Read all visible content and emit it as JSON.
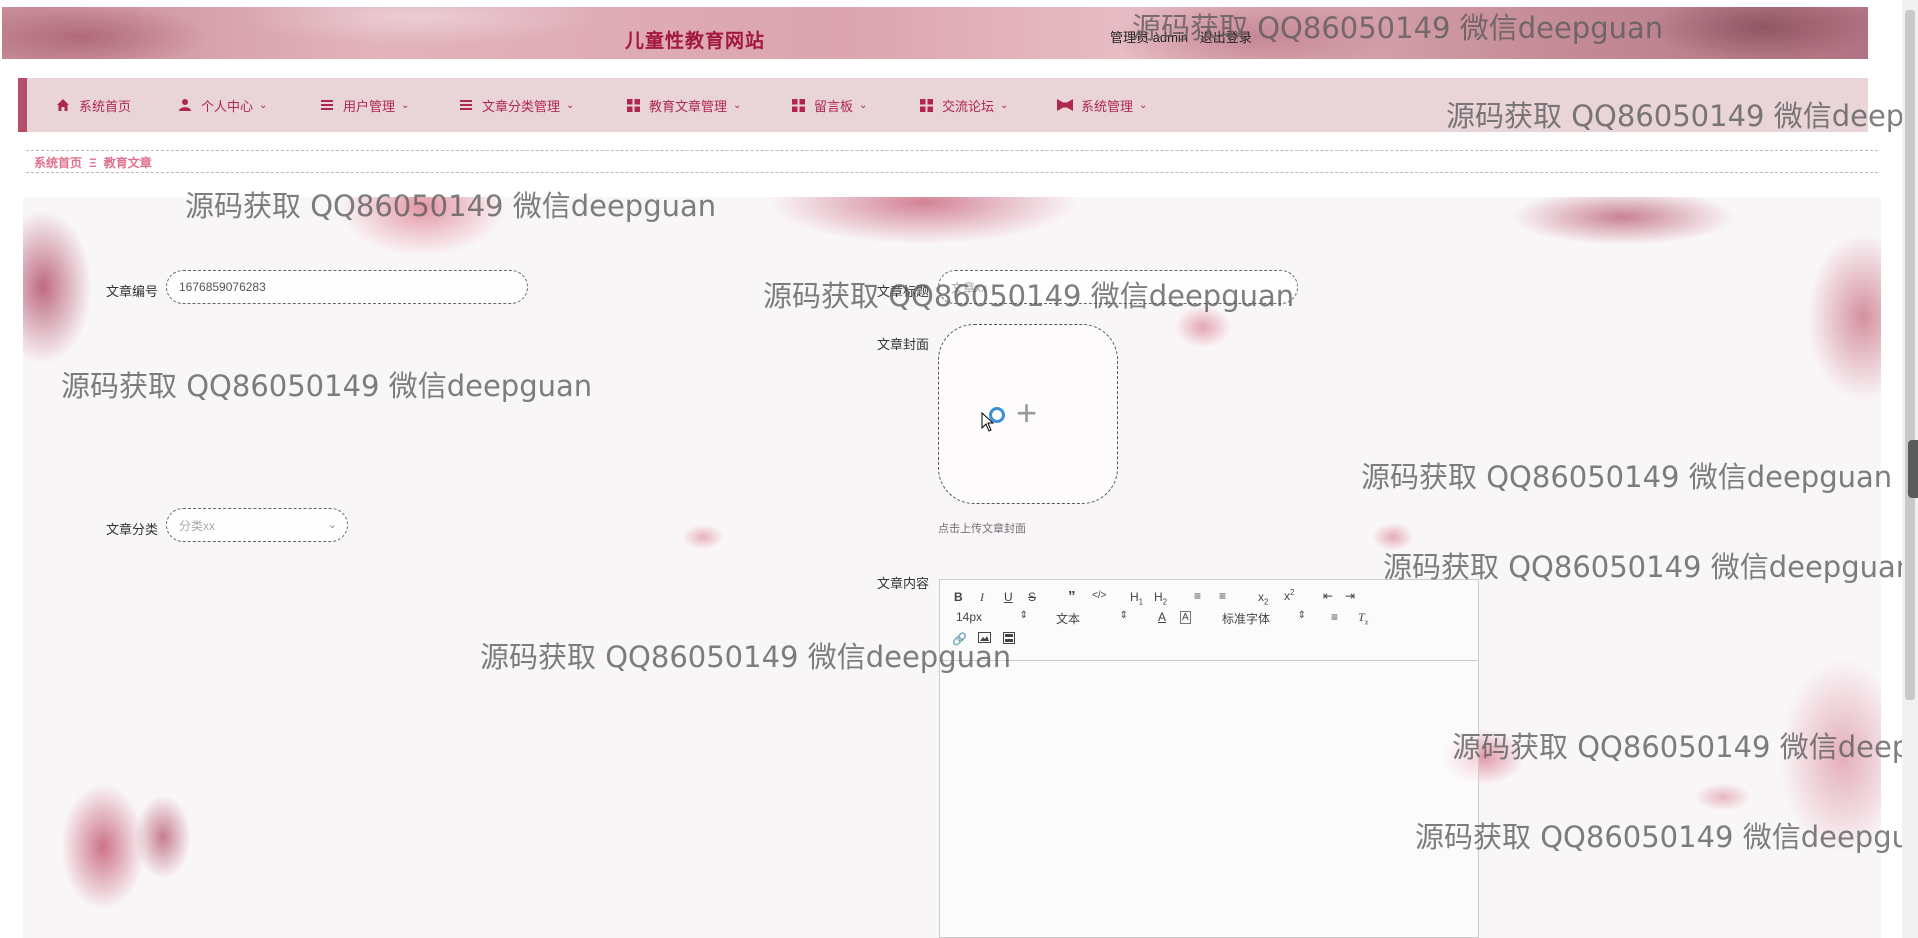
{
  "header": {
    "site_title": "儿童性教育网站",
    "user_role": "管理员",
    "username": "admin",
    "logout": "退出登录"
  },
  "nav": {
    "items": [
      {
        "label": "系统首页",
        "icon": "home-icon",
        "dropdown": false
      },
      {
        "label": "个人中心",
        "icon": "user-icon",
        "dropdown": true
      },
      {
        "label": "用户管理",
        "icon": "list-icon",
        "dropdown": true
      },
      {
        "label": "文章分类管理",
        "icon": "list-icon",
        "dropdown": true
      },
      {
        "label": "教育文章管理",
        "icon": "grid-icon",
        "dropdown": true
      },
      {
        "label": "留言板",
        "icon": "grid-icon",
        "dropdown": true
      },
      {
        "label": "交流论坛",
        "icon": "grid-icon",
        "dropdown": true
      },
      {
        "label": "系统管理",
        "icon": "bowtie-icon",
        "dropdown": true
      }
    ]
  },
  "breadcrumb": {
    "home": "系统首页",
    "separator": "Ξ",
    "current": "教育文章"
  },
  "form": {
    "article_no_label": "文章编号",
    "article_no_value": "1676859076283",
    "title_label": "文章标题",
    "title_placeholder": "文章xx",
    "cover_label": "文章封面",
    "cover_tip": "点击上传文章封面",
    "category_label": "文章分类",
    "category_placeholder": "分类xx",
    "content_label": "文章内容"
  },
  "editor": {
    "font_size": "14px",
    "block_format": "文本",
    "font_family": "标准字体"
  },
  "watermark": "源码获取 QQ86050149 微信deepguan",
  "colors": {
    "brand": "#a3183c",
    "nav_text": "#b0274e",
    "nav_bg": "#e9d4d8",
    "breadcrumb": "#e0718e"
  }
}
